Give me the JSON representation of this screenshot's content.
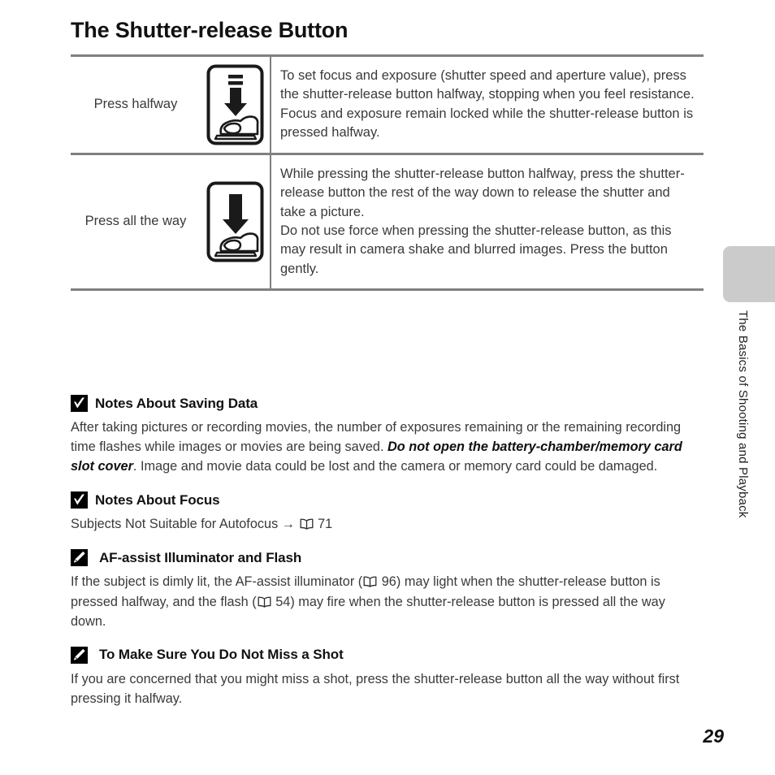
{
  "page": {
    "title": "The Shutter-release Button",
    "number": "29",
    "side_tab_label": "The Basics of Shooting and Playback"
  },
  "table": {
    "rows": [
      {
        "label": "Press halfway",
        "icon": "press-halfway-icon",
        "body": "To set focus and exposure (shutter speed and aperture value), press the shutter-release button halfway, stopping when you feel resistance. Focus and exposure remain locked while the shutter-release button is pressed halfway."
      },
      {
        "label": "Press all the way",
        "icon": "press-all-the-way-icon",
        "body_1": "While pressing the shutter-release button halfway, press the shutter-release button the rest of the way down to release the shutter and take a picture.",
        "body_2": "Do not use force when pressing the shutter-release button, as this may result in camera shake and blurred images. Press the button gently."
      }
    ]
  },
  "notes": [
    {
      "icon": "checkmark-badge-icon",
      "title": "Notes About Saving Data",
      "body_before": "After taking pictures or recording movies, the number of exposures remaining or the remaining recording time flashes while images or movies are being saved. ",
      "body_emphasis": "Do not open the battery-chamber/memory card slot cover",
      "body_after": ". Image and movie data could be lost and the camera or memory card could be damaged."
    },
    {
      "icon": "checkmark-badge-icon",
      "title": "Notes About Focus",
      "body_before": "Subjects Not Suitable for Autofocus → ",
      "ref_page": "71",
      "body_after": ""
    },
    {
      "icon": "pencil-badge-icon",
      "title": "AF-assist Illuminator and Flash",
      "body_before": "If the subject is dimly lit, the AF-assist illuminator (",
      "ref_page_1": "96",
      "body_middle": ") may light when the shutter-release button is pressed halfway, and the flash (",
      "ref_page_2": "54",
      "body_after": ") may fire when the shutter-release button is pressed all the way down."
    },
    {
      "icon": "pencil-badge-icon",
      "title": "To Make Sure You Do Not Miss a Shot",
      "body_before": "If you are concerned that you might miss a shot, press the shutter-release button all the way without first pressing it halfway.",
      "body_after": ""
    }
  ],
  "colors": {
    "rule": "#808080",
    "tab": "#cbcbcb",
    "text": "#3a3a3a",
    "heading": "#111111"
  }
}
